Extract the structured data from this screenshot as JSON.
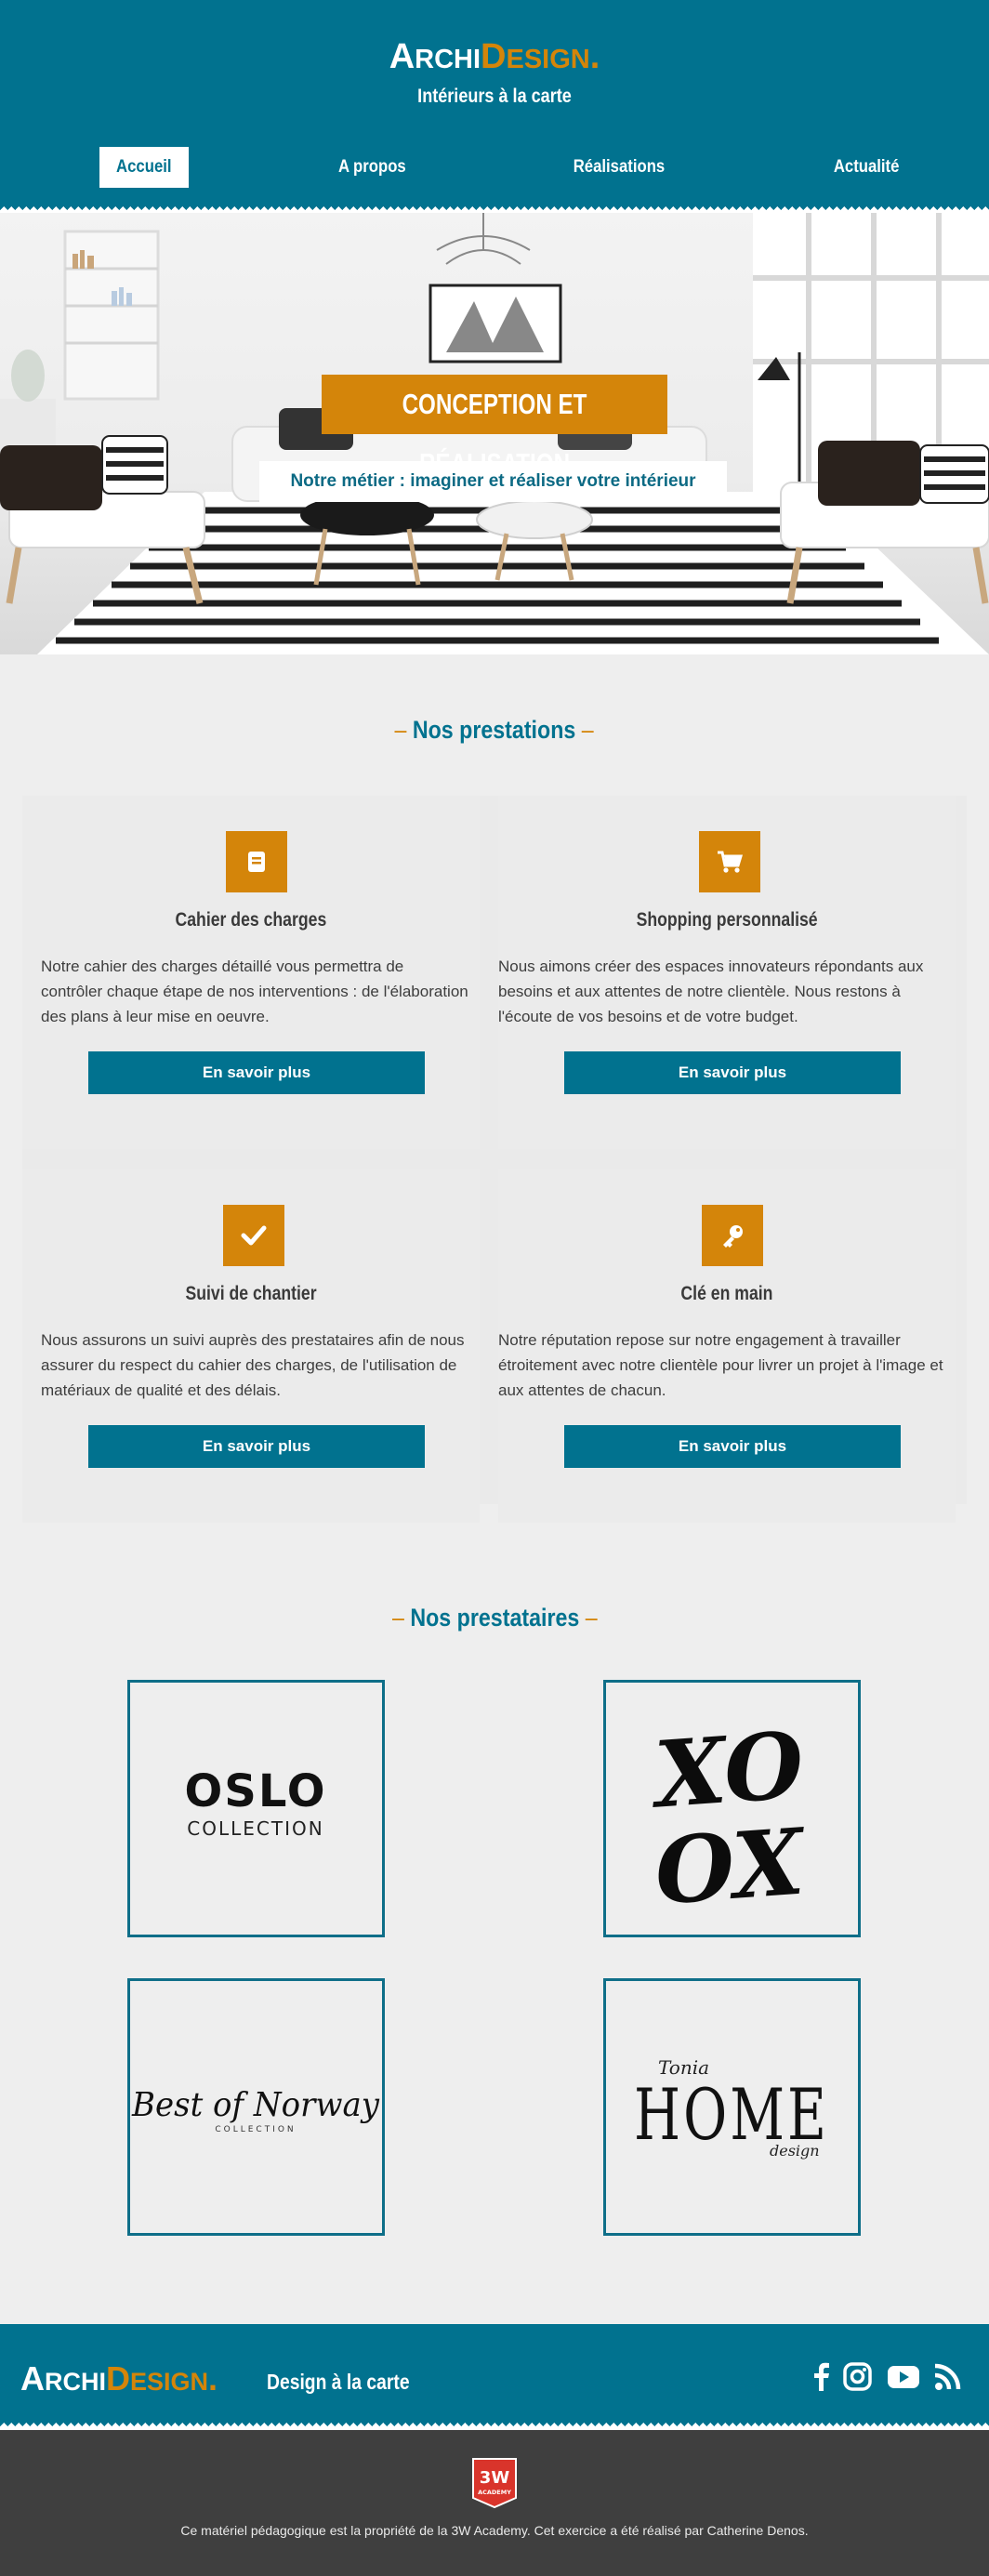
{
  "header": {
    "logo": {
      "part1_cap": "A",
      "part1_rest": "RCHI",
      "part2_cap": "D",
      "part2_rest": "ESIGN",
      "dot": "."
    },
    "tagline": "Intérieurs à la carte",
    "nav": [
      {
        "label": "Accueil",
        "active": true
      },
      {
        "label": "A propos",
        "active": false
      },
      {
        "label": "Réalisations",
        "active": false
      },
      {
        "label": "Actualité",
        "active": false
      }
    ]
  },
  "hero": {
    "title": "CONCEPTION ET RÉALISATION",
    "subtitle": "Notre métier : imaginer et réaliser votre intérieur"
  },
  "services": {
    "title": "Nos prestations",
    "cards": [
      {
        "icon": "book-icon",
        "title": "Cahier des charges",
        "text": "Notre cahier des charges détaillé vous permettra de contrôler chaque étape de nos interventions : de l'élaboration des plans à leur mise en oeuvre.",
        "button": "En savoir plus"
      },
      {
        "icon": "cart-icon",
        "title": "Shopping personnalisé",
        "text": "Nous aimons créer des espaces innovateurs répondants aux besoins et aux attentes de notre clientèle. Nous restons à l'écoute de vos besoins et de votre budget.",
        "button": "En savoir plus"
      },
      {
        "icon": "check-icon",
        "title": "Suivi de chantier",
        "text": "Nous assurons un suivi auprès des prestataires afin de nous assurer du respect du cahier des charges, de l'utilisation de matériaux de qualité et des délais.",
        "button": "En savoir plus"
      },
      {
        "icon": "key-icon",
        "title": "Clé en main",
        "text": "Notre réputation repose sur notre engagement à travailler étroitement avec notre clientèle pour livrer un projet à l'image et aux attentes de chacun.",
        "button": "En savoir plus"
      }
    ]
  },
  "partners": {
    "title": "Nos prestataires",
    "items": [
      {
        "line1": "OSLO",
        "line2": "COLLECTION"
      },
      {
        "line1": "XO",
        "line2": "OX"
      },
      {
        "line1": "Best of Norway",
        "line2": "COLLECTION"
      },
      {
        "line1": "Tonia",
        "line2": "HOME",
        "line3": "design"
      }
    ]
  },
  "footer": {
    "tagline": "Design à la carte",
    "social": [
      "facebook-icon",
      "instagram-icon",
      "youtube-icon",
      "rss-icon"
    ],
    "badge": {
      "top": "3W",
      "bottom": "ACADEMY"
    },
    "copyright": "Ce matériel pédagogique est la propriété de la 3W Academy. Cet exercice a été réalisé par Catherine Denos."
  },
  "colors": {
    "primary": "#01728f",
    "accent": "#d4850a",
    "background": "#eeeeee",
    "footer_dark": "#3f3f3f"
  }
}
